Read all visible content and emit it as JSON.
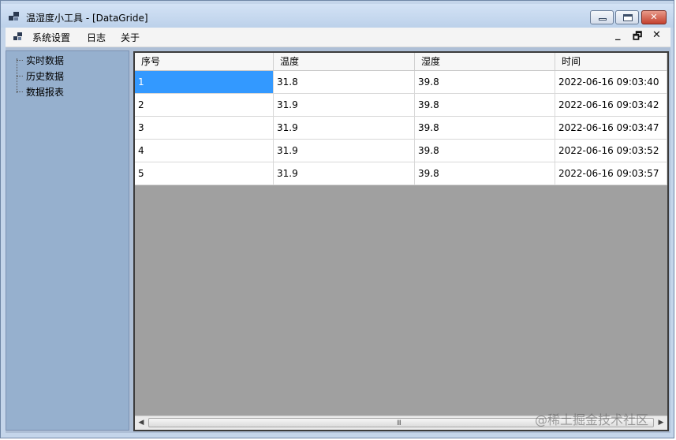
{
  "window": {
    "title": "温湿度小工具 - [DataGride]"
  },
  "menu": {
    "items": [
      "系统设置",
      "日志",
      "关于"
    ],
    "mdi_controls": [
      "_",
      "🗗",
      "✕"
    ]
  },
  "tree": {
    "nodes": [
      "实时数据",
      "历史数据",
      "数据报表"
    ]
  },
  "grid": {
    "columns": [
      "序号",
      "温度",
      "湿度",
      "时间"
    ],
    "rows": [
      [
        "1",
        "31.8",
        "39.8",
        "2022-06-16 09:03:40"
      ],
      [
        "2",
        "31.9",
        "39.8",
        "2022-06-16 09:03:42"
      ],
      [
        "3",
        "31.9",
        "39.8",
        "2022-06-16 09:03:47"
      ],
      [
        "4",
        "31.9",
        "39.8",
        "2022-06-16 09:03:52"
      ],
      [
        "5",
        "31.9",
        "39.8",
        "2022-06-16 09:03:57"
      ]
    ],
    "selected_cell": "row 1, column 序号"
  },
  "scrollbar": {
    "grip": "III"
  },
  "watermark": "@稀土掘金技术社区",
  "colors": {
    "selection": "#3399ff",
    "tree_background": "#96b0ce",
    "grid_empty_area": "#a0a0a0"
  }
}
